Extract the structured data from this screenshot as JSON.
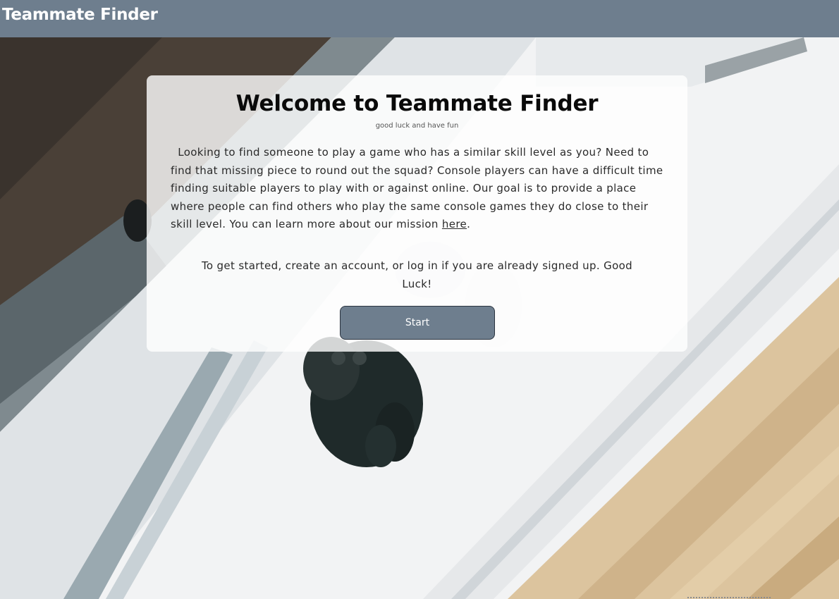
{
  "navbar": {
    "brand": "Teammate Finder"
  },
  "card": {
    "title": "Welcome to Teammate Finder",
    "subtitle": "good luck and have fun",
    "intro_text": "Looking to find someone to play a game who has a similar skill level as you? Need to find that missing piece to round out the squad? Console players can have a difficult time finding suitable players to play with or against online. Our goal is to provide a place where people can find others who play the same console games they do close to their skill level. You can learn more about our mission ",
    "intro_link": "here",
    "intro_end": ".",
    "cta_text": "To get started, create an account, or log in if you are already signed up. Good Luck!",
    "start_label": "Start"
  },
  "colors": {
    "navbar": "#6e7e8e",
    "button": "#6e7e8e",
    "button_border": "#2b3440"
  },
  "hero": {
    "image_subject": "game-controller-photo"
  }
}
